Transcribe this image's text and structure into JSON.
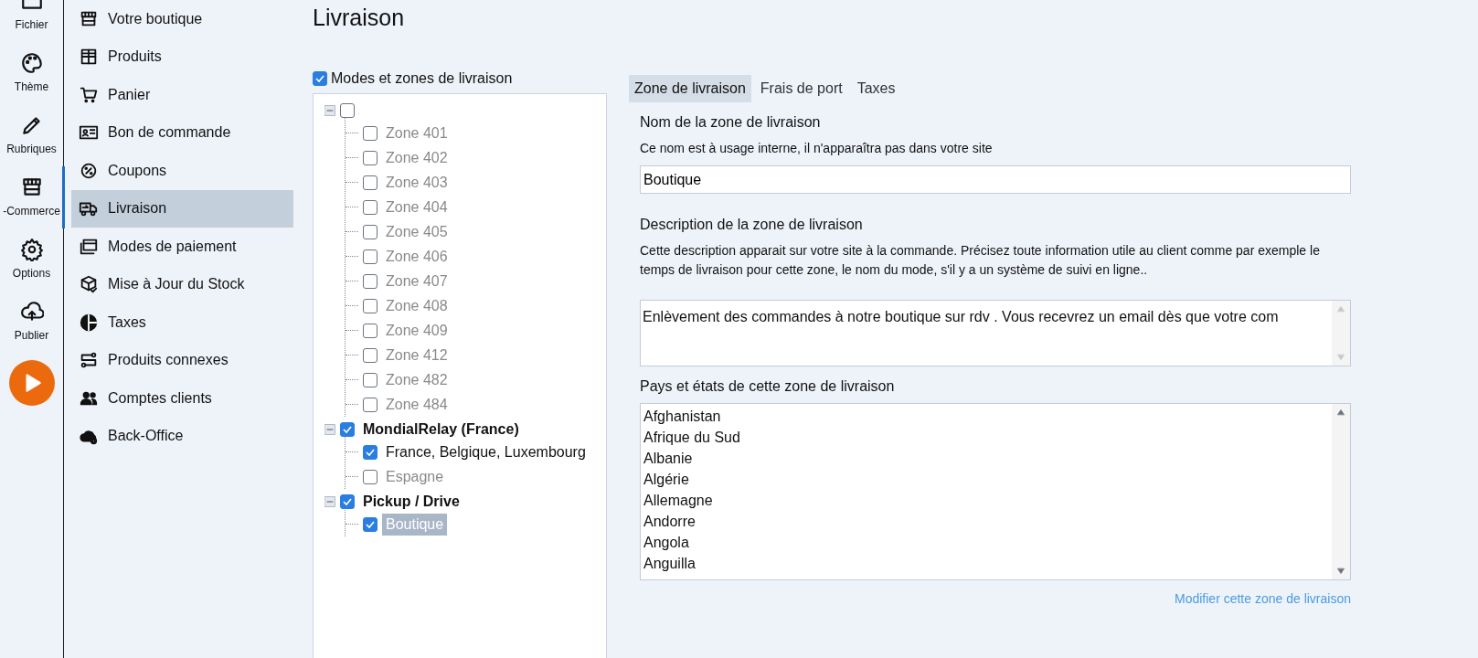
{
  "rail": {
    "items": [
      {
        "label": "Fichier",
        "selected": false
      },
      {
        "label": "Thème",
        "selected": false
      },
      {
        "label": "Rubriques",
        "selected": false
      },
      {
        "label": "-Commerce",
        "selected": true
      },
      {
        "label": "Options",
        "selected": false
      },
      {
        "label": "Publier",
        "selected": false
      }
    ]
  },
  "nav": {
    "items": [
      {
        "label": "Votre boutique",
        "selected": false
      },
      {
        "label": "Produits",
        "selected": false
      },
      {
        "label": "Panier",
        "selected": false
      },
      {
        "label": "Bon de commande",
        "selected": false
      },
      {
        "label": "Coupons",
        "selected": false
      },
      {
        "label": "Livraison",
        "selected": true
      },
      {
        "label": "Modes de paiement",
        "selected": false
      },
      {
        "label": "Mise à Jour du Stock",
        "selected": false
      },
      {
        "label": "Taxes",
        "selected": false
      },
      {
        "label": "Produits connexes",
        "selected": false
      },
      {
        "label": "Comptes clients",
        "selected": false
      },
      {
        "label": "Back-Office",
        "selected": false
      }
    ]
  },
  "page": {
    "title": "Livraison"
  },
  "tree": {
    "header": {
      "label": "Modes et zones de livraison",
      "checked": true
    },
    "nodes": [
      {
        "checked": false,
        "expanded": true,
        "children": [
          {
            "label": "Zone 401",
            "checked": false,
            "selected": false
          },
          {
            "label": "Zone 402",
            "checked": false,
            "selected": false
          },
          {
            "label": "Zone 403",
            "checked": false,
            "selected": false
          },
          {
            "label": "Zone 404",
            "checked": false,
            "selected": false
          },
          {
            "label": "Zone 405",
            "checked": false,
            "selected": false
          },
          {
            "label": "Zone 406",
            "checked": false,
            "selected": false
          },
          {
            "label": "Zone 407",
            "checked": false,
            "selected": false
          },
          {
            "label": "Zone 408",
            "checked": false,
            "selected": false
          },
          {
            "label": "Zone 409",
            "checked": false,
            "selected": false
          },
          {
            "label": "Zone 412",
            "checked": false,
            "selected": false
          },
          {
            "label": "Zone 482",
            "checked": false,
            "selected": false
          },
          {
            "label": "Zone 484",
            "checked": false,
            "selected": false
          }
        ]
      },
      {
        "label": "MondialRelay (France)",
        "checked": true,
        "expanded": true,
        "children": [
          {
            "label": "France, Belgique, Luxembourg",
            "checked": true,
            "selected": false
          },
          {
            "label": "Espagne",
            "checked": false,
            "selected": false
          }
        ]
      },
      {
        "label": "Pickup / Drive",
        "checked": true,
        "expanded": true,
        "children": [
          {
            "label": "Boutique",
            "checked": true,
            "selected": true
          }
        ]
      }
    ]
  },
  "tabs": [
    {
      "label": "Zone de livraison",
      "selected": true
    },
    {
      "label": "Frais de port",
      "selected": false
    },
    {
      "label": "Taxes",
      "selected": false
    }
  ],
  "form": {
    "name_label": "Nom de la zone de livraison",
    "name_hint": "Ce nom est à usage interne, il n'apparaîtra pas dans votre site",
    "name_value": "Boutique",
    "description_label": "Description de la zone de livraison",
    "description_hint": "Cette description apparait sur votre site à la commande. Précisez toute information utile au client comme par exemple le temps de livraison pour cette zone, le nom du mode, s'il y a un système de suivi en ligne..",
    "description_value": "Enlèvement des commandes à notre boutique sur rdv . Vous recevrez un email dès que votre com",
    "countries_label": "Pays et états de cette zone de livraison",
    "countries": [
      "Afghanistan",
      "Afrique du Sud",
      "Albanie",
      "Algérie",
      "Allemagne",
      "Andorre",
      "Angola",
      "Anguilla"
    ],
    "link": "Modifier cette zone de livraison"
  }
}
